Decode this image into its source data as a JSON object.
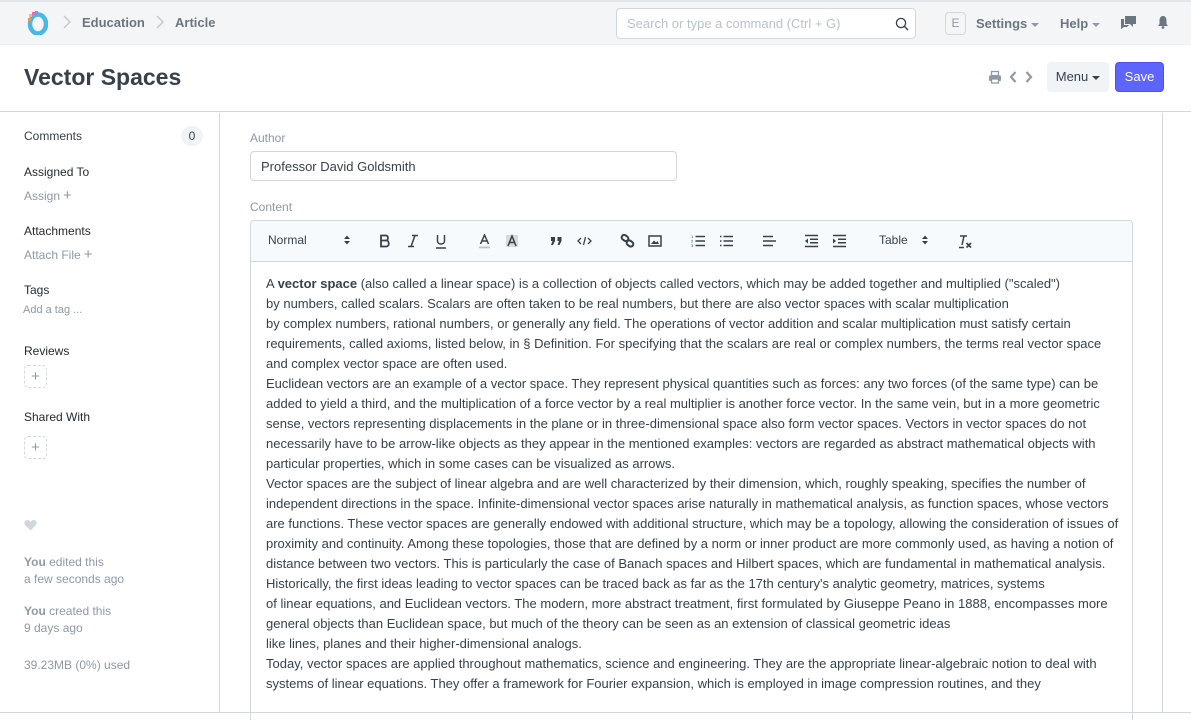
{
  "navbar": {
    "breadcrumbs": [
      "Education",
      "Article"
    ],
    "search_placeholder": "Search or type a command (Ctrl + G)",
    "user_initial": "E",
    "settings_label": "Settings",
    "help_label": "Help",
    "icons": [
      "logo-icon",
      "chevron-right-icon",
      "search-icon",
      "chat-icon",
      "bell-icon"
    ]
  },
  "page": {
    "title": "Vector Spaces",
    "menu_label": "Menu",
    "save_label": "Save",
    "icons": [
      "print-icon",
      "previous-icon",
      "next-icon"
    ]
  },
  "sidebar": {
    "comments_label": "Comments",
    "comments_count": "0",
    "assigned_to_label": "Assigned To",
    "assign_link": "Assign",
    "attachments_label": "Attachments",
    "attach_link": "Attach File",
    "tags_label": "Tags",
    "add_tag_link": "Add a tag ...",
    "reviews_label": "Reviews",
    "shared_with_label": "Shared With",
    "plus": "+",
    "activity": [
      {
        "actor": "You",
        "action": " edited this",
        "when": "a few seconds ago"
      },
      {
        "actor": "You",
        "action": " created this",
        "when": "9 days ago"
      }
    ],
    "storage_used": "39.23MB (0%) used"
  },
  "form": {
    "author_label": "Author",
    "author_value": "Professor David Goldsmith",
    "content_label": "Content",
    "toolbar": {
      "heading_select": "Normal",
      "table_select": "Table",
      "buttons": [
        "bold",
        "italic",
        "underline",
        "text-color",
        "background-color",
        "blockquote",
        "code-block",
        "link",
        "image",
        "ordered-list",
        "bullet-list",
        "align",
        "outdent",
        "indent",
        "clear-format"
      ]
    },
    "content": {
      "p1_prefix": "A ",
      "p1_bold": "vector space",
      "p1_line1_rest": " (also called a linear space) is a collection of objects called vectors, which may be added together and multiplied (\"scaled\")",
      "p1_line2": "by numbers, called scalars. Scalars are often taken to be real numbers, but there are also vector spaces with scalar multiplication",
      "p1_line3": "by complex numbers, rational numbers, or generally any field. The operations of vector addition and scalar multiplication must satisfy certain requirements, called axioms, listed below, in § Definition. For specifying that the scalars are real or complex numbers, the terms real vector space and complex vector space are often used.",
      "p2": "Euclidean vectors are an example of a vector space. They represent physical quantities such as forces: any two forces (of the same type) can be added to yield a third, and the multiplication of a force vector by a real multiplier is another force vector. In the same vein, but in a more geometric sense, vectors representing displacements in the plane or in three-dimensional space also form vector spaces. Vectors in vector spaces do not necessarily have to be arrow-like objects as they appear in the mentioned examples: vectors are regarded as abstract mathematical objects with particular properties, which in some cases can be visualized as arrows.",
      "p3": "Vector spaces are the subject of linear algebra and are well characterized by their dimension, which, roughly speaking, specifies the number of independent directions in the space. Infinite-dimensional vector spaces arise naturally in mathematical analysis, as function spaces, whose vectors are functions. These vector spaces are generally endowed with additional structure, which may be a topology, allowing the consideration of issues of proximity and continuity. Among these topologies, those that are defined by a norm or inner product are more commonly used, as having a notion of distance between two vectors. This is particularly the case of Banach spaces and Hilbert spaces, which are fundamental in mathematical analysis.",
      "p4_line1": "Historically, the first ideas leading to vector spaces can be traced back as far as the 17th century's analytic geometry, matrices, systems",
      "p4_line2": "of linear equations, and Euclidean vectors. The modern, more abstract treatment, first formulated by Giuseppe Peano in 1888, encompasses more general objects than Euclidean space, but much of the theory can be seen as an extension of classical geometric ideas",
      "p4_line3": "like lines, planes and their higher-dimensional analogs.",
      "p5": "Today, vector spaces are applied throughout mathematics, science and engineering. They are the appropriate linear-algebraic notion to deal with systems of linear equations. They offer a framework for Fourier expansion, which is employed in image compression routines, and they"
    }
  },
  "colors": {
    "primary": "#5e64ff",
    "text": "#36414c",
    "muted": "#8d99a6",
    "border": "#d1d8dd"
  }
}
